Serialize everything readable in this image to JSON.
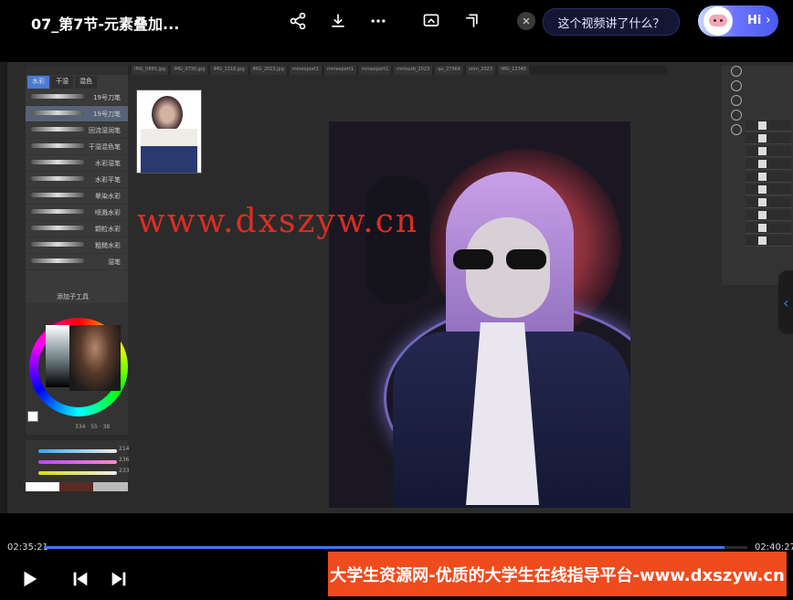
{
  "header": {
    "title": "07_第7节-元素叠加...",
    "ask_prompt": "这个视频讲了什么？",
    "assistant_label": "Hi",
    "icons": [
      "share-icon",
      "download-icon",
      "more-icon",
      "screen-cast-icon",
      "pip-icon",
      "close-icon"
    ]
  },
  "app_screen": {
    "brush_panel": {
      "tabs": [
        "水彩",
        "干湿",
        "混色"
      ],
      "brushes": [
        "19号刀笔",
        "19号刀笔",
        "回流湿润笔",
        "干湿混色笔",
        "水彩湿笔",
        "水彩平笔",
        "晕染水彩",
        "喷溅水彩",
        "颗粒水彩",
        "粗糙水彩",
        "湿笔"
      ],
      "add_tool": "添加子工具"
    },
    "color_values": {
      "h": "334",
      "s": "55",
      "v": "38"
    },
    "slider_values": [
      "214",
      "236",
      "233"
    ],
    "watermark": "www.dxszyw.cn"
  },
  "player": {
    "current_time": "02:35:21",
    "total_time": "02:40:27",
    "progress": 0.968,
    "banner_text": "大学生资源网-优质的大学生在线指导平台-www.dxszyw.cn"
  },
  "colors": {
    "accent": "#3b78e7",
    "banner": "#ee4b1e",
    "watermark": "#e62e22"
  }
}
